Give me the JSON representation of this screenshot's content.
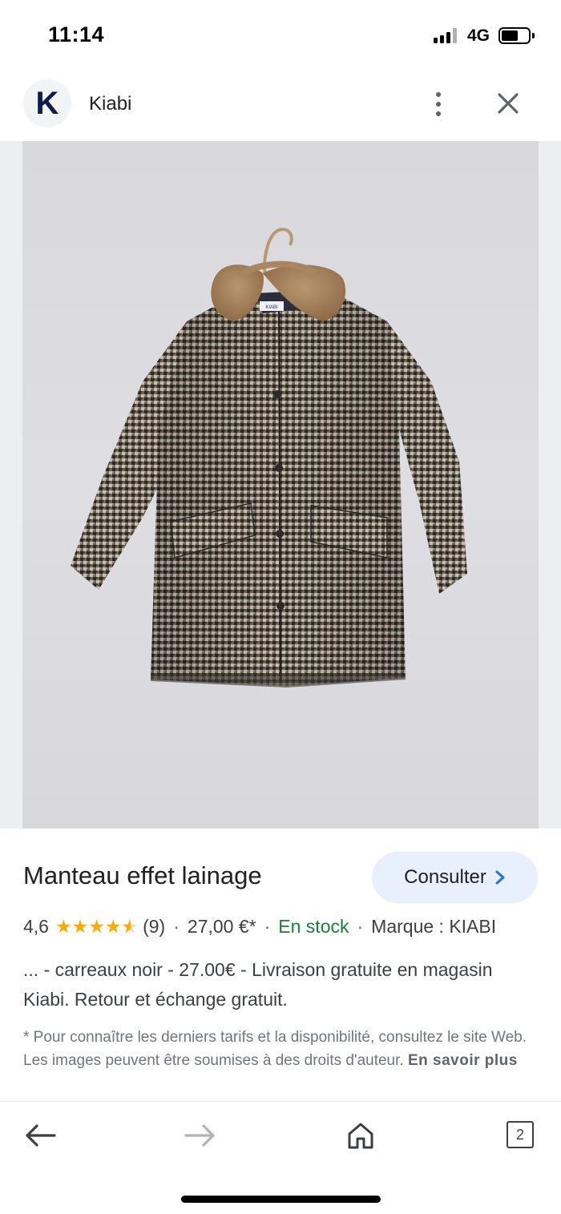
{
  "status_bar": {
    "time": "11:14",
    "network": "4G",
    "battery_level": 0.62
  },
  "header": {
    "logo_letter": "K",
    "site_name": "Kiabi",
    "menu_icon": "more-vert-icon",
    "close_icon": "close-icon"
  },
  "image": {
    "label_text": "KIABI",
    "alt": "product photo"
  },
  "product": {
    "title": "Manteau effet lainage",
    "consult_label": "Consulter",
    "rating": "4,6",
    "rating_value": 4.6,
    "reviews": "(9)",
    "price": "27,00 €*",
    "stock": "En stock",
    "brand": "Marque : KIABI",
    "sep": "·",
    "description": "... - carreaux noir - 27.00€ - Livraison gratuite en magasin Kiabi. Retour et échange gratuit.",
    "disclaimer": "* Pour connaître les derniers tarifs et la disponibilité, consultez le site Web. Les images peuvent être soumises à des droits d'auteur.",
    "learn_more": "En savoir plus"
  },
  "bottom_bar": {
    "tabs_count": "2",
    "icons": [
      "back-arrow-icon",
      "forward-arrow-icon",
      "home-icon",
      "tabs-icon"
    ]
  },
  "colors": {
    "accent_button_bg": "#e8f0fe",
    "star": "#f9ab00",
    "stock_green": "#188038",
    "logo_navy": "#0b1d4f"
  }
}
